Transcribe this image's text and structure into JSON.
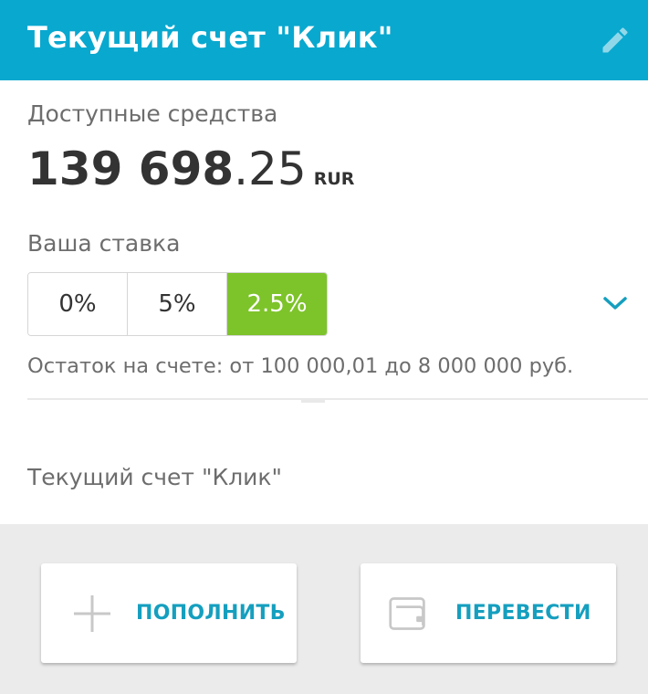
{
  "header": {
    "title": "Текущий счет \"Клик\"",
    "edit_icon": "pencil-icon"
  },
  "funds": {
    "label": "Доступные средства",
    "amount_integer": "139 698",
    "amount_decimal": ".25",
    "currency": "RUR"
  },
  "rate": {
    "label": "Ваша ставка",
    "options": [
      "0%",
      "5%",
      "2.5%"
    ],
    "selected_index": 2,
    "expand_icon": "chevron-down-icon"
  },
  "balance_range": "Остаток на счете: от 100 000,01 до 8 000 000 руб.",
  "account_name": "Текущий счет \"Клик\"",
  "actions": {
    "topup_label": "ПОПОЛНИТЬ",
    "topup_icon": "plus-icon",
    "transfer_label": "ПЕРЕВЕСТИ",
    "transfer_icon": "wallet-icon"
  },
  "colors": {
    "header_bg": "#09a8cf",
    "selected_rate": "#7dc32a",
    "accent_text": "#159fbf"
  }
}
